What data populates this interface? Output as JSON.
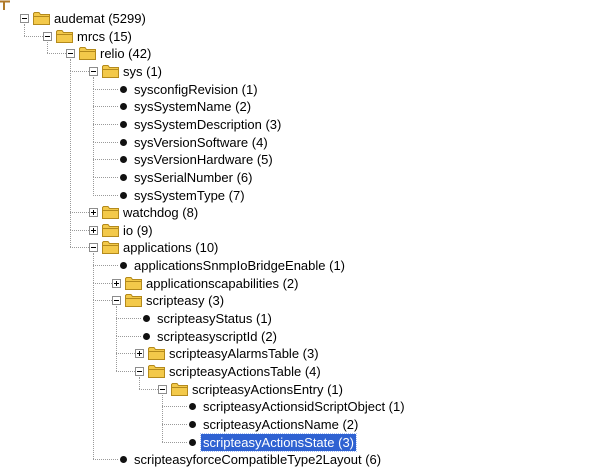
{
  "tree": {
    "nodes": [
      {
        "label": "audemat (5299)",
        "depth": 0,
        "kind": "folder",
        "toggle": "minus"
      },
      {
        "label": "mrcs (15)",
        "depth": 1,
        "kind": "folder",
        "toggle": "minus"
      },
      {
        "label": "relio (42)",
        "depth": 2,
        "kind": "folder",
        "toggle": "minus"
      },
      {
        "label": "sys (1)",
        "depth": 3,
        "kind": "folder",
        "toggle": "minus"
      },
      {
        "label": "sysconfigRevision (1)",
        "depth": 4,
        "kind": "leaf"
      },
      {
        "label": "sysSystemName (2)",
        "depth": 4,
        "kind": "leaf"
      },
      {
        "label": "sysSystemDescription (3)",
        "depth": 4,
        "kind": "leaf"
      },
      {
        "label": "sysVersionSoftware (4)",
        "depth": 4,
        "kind": "leaf"
      },
      {
        "label": "sysVersionHardware (5)",
        "depth": 4,
        "kind": "leaf"
      },
      {
        "label": "sysSerialNumber (6)",
        "depth": 4,
        "kind": "leaf"
      },
      {
        "label": "sysSystemType (7)",
        "depth": 4,
        "kind": "leaf"
      },
      {
        "label": "watchdog (8)",
        "depth": 3,
        "kind": "folder",
        "toggle": "plus"
      },
      {
        "label": "io (9)",
        "depth": 3,
        "kind": "folder",
        "toggle": "plus"
      },
      {
        "label": "applications (10)",
        "depth": 3,
        "kind": "folder",
        "toggle": "minus"
      },
      {
        "label": "applicationsSnmpIoBridgeEnable (1)",
        "depth": 4,
        "kind": "leaf"
      },
      {
        "label": "applicationscapabilities (2)",
        "depth": 4,
        "kind": "folder",
        "toggle": "plus"
      },
      {
        "label": "scripteasy (3)",
        "depth": 4,
        "kind": "folder",
        "toggle": "minus"
      },
      {
        "label": "scripteasyStatus (1)",
        "depth": 5,
        "kind": "leaf"
      },
      {
        "label": "scripteasyscriptId (2)",
        "depth": 5,
        "kind": "leaf"
      },
      {
        "label": "scripteasyAlarmsTable (3)",
        "depth": 5,
        "kind": "folder",
        "toggle": "plus"
      },
      {
        "label": "scripteasyActionsTable (4)",
        "depth": 5,
        "kind": "folder",
        "toggle": "minus"
      },
      {
        "label": "scripteasyActionsEntry (1)",
        "depth": 6,
        "kind": "folder",
        "toggle": "minus"
      },
      {
        "label": "scripteasyActionsidScriptObject (1)",
        "depth": 7,
        "kind": "leaf"
      },
      {
        "label": "scripteasyActionsName (2)",
        "depth": 7,
        "kind": "leaf"
      },
      {
        "label": "scripteasyActionsState (3)",
        "depth": 7,
        "kind": "leaf",
        "selected": true
      },
      {
        "label": "scripteasyforceCompatibleType2Layout (6)",
        "depth": 4,
        "kind": "leaf"
      }
    ]
  },
  "colors": {
    "selection": "#2f62d2",
    "folder": "#f3c94a",
    "folder_dark": "#b48a1c"
  }
}
